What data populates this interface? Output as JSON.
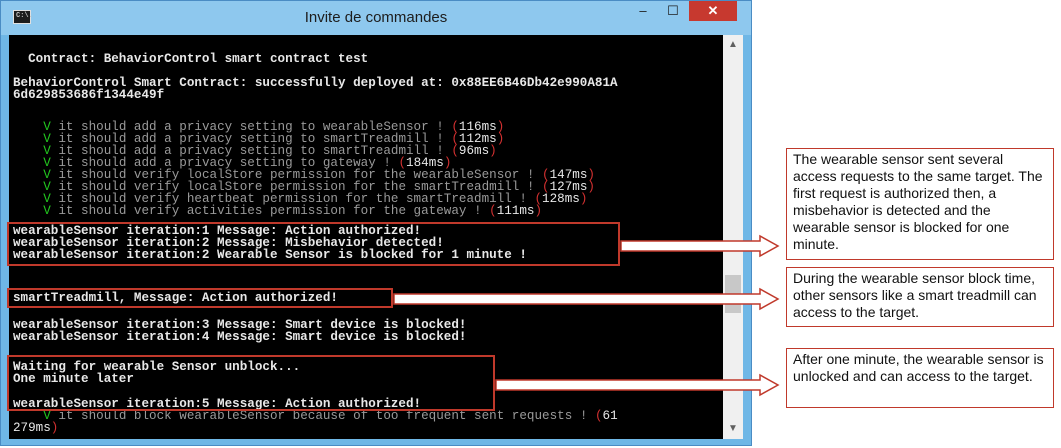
{
  "window": {
    "title": "Invite de commandes",
    "icon_text": "C:\\.",
    "minimize_glyph": "–",
    "maximize_glyph": "☐",
    "close_glyph": "✕"
  },
  "console": {
    "lines": [
      {
        "text": "  Contract: BehaviorControl smart contract test"
      },
      {
        "text": "BehaviorControl Smart Contract: successfully deployed at: 0x88EE6B46Db42e990A81A"
      },
      {
        "text": "6d629853686f1344e49f"
      },
      {
        "check": "V",
        "text": "it should add a privacy setting to wearableSensor ! ",
        "time": "116ms"
      },
      {
        "check": "V",
        "text": "it should add a privacy setting to smartTreadmill ! ",
        "time": "112ms"
      },
      {
        "check": "V",
        "text": "it should add a privacy setting to smartTreadmill ! ",
        "time": "96ms"
      },
      {
        "check": "V",
        "text": "it should add a privacy setting to gateway ! ",
        "time": "184ms"
      },
      {
        "check": "V",
        "text": "it should verify localStore permission for the wearableSensor ! ",
        "time": "147ms"
      },
      {
        "check": "V",
        "text": "it should verify localStore permission for the smartTreadmill ! ",
        "time": "127ms"
      },
      {
        "check": "V",
        "text": "it should verify heartbeat permission for the smartTreadmill ! ",
        "time": "128ms"
      },
      {
        "check": "V",
        "text": "it should verify activities permission for the gateway ! ",
        "time": "111ms"
      },
      {
        "text": "wearableSensor iteration:1 Message: Action authorized!"
      },
      {
        "text": "wearableSensor iteration:2 Message: Misbehavior detected!"
      },
      {
        "text": "wearableSensor iteration:2 Wearable Sensor is blocked for 1 minute !"
      },
      {
        "text": "smartTreadmill, Message: Action authorized!"
      },
      {
        "text": "wearableSensor iteration:3 Message: Smart device is blocked!"
      },
      {
        "text": "wearableSensor iteration:4 Message: Smart device is blocked!"
      },
      {
        "text": "Waiting for wearable Sensor unblock..."
      },
      {
        "text": "One minute later"
      },
      {
        "text": "wearableSensor iteration:5 Message: Action authorized!"
      },
      {
        "check": "V",
        "text": "it should block wearableSensor because of too frequent sent requests ! ",
        "time": "61"
      },
      {
        "text": "279ms"
      }
    ]
  },
  "annotations": [
    {
      "text": "The wearable sensor sent several access requests to the same target. The first request is authorized then, a misbehavior is detected and the wearable sensor is blocked for one minute."
    },
    {
      "text": "During the wearable sensor block time, other sensors like a smart treadmill can access to the target."
    },
    {
      "text": "After one minute, the wearable sensor is unlocked and can access to the target."
    }
  ],
  "colors": {
    "titlebar": "#8ec8ee",
    "console_bg": "#000000",
    "check_green": "#22c71f",
    "highlight_red": "#c0392b"
  }
}
